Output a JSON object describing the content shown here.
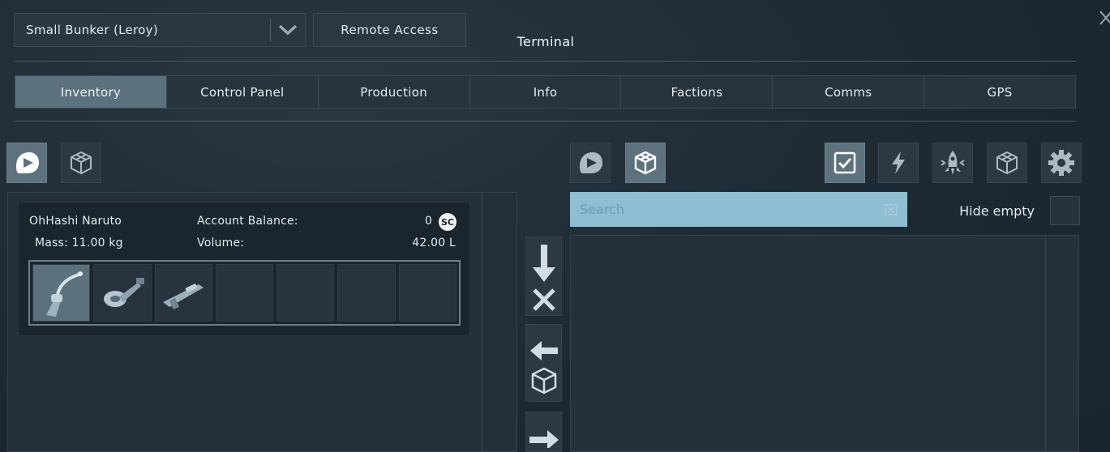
{
  "header": {
    "grid_selector": {
      "value": "Small Bunker (Leroy)"
    },
    "remote_access_label": "Remote Access",
    "title": "Terminal"
  },
  "tabs": [
    {
      "label": "Inventory",
      "active": true
    },
    {
      "label": "Control Panel",
      "active": false
    },
    {
      "label": "Production",
      "active": false
    },
    {
      "label": "Info",
      "active": false
    },
    {
      "label": "Factions",
      "active": false
    },
    {
      "label": "Comms",
      "active": false
    },
    {
      "label": "GPS",
      "active": false
    }
  ],
  "left": {
    "filter_buttons": [
      {
        "icon": "character-helmet-icon",
        "active": true
      },
      {
        "icon": "grid-cubes-icon",
        "active": false
      }
    ],
    "character": {
      "name": "OhHashi Naruto",
      "mass": "Mass: 11.00 kg",
      "balance_label": "Account Balance:",
      "balance_value": "0",
      "currency_badge": "SC",
      "volume_label": "Volume:",
      "volume_value": "42.00 L",
      "slots": [
        {
          "item": "welder-tool-icon",
          "selected": true
        },
        {
          "item": "grinder-tool-icon",
          "selected": false
        },
        {
          "item": "rifle-icon",
          "selected": false
        },
        {
          "item": "",
          "selected": false
        },
        {
          "item": "",
          "selected": false
        },
        {
          "item": "",
          "selected": false
        },
        {
          "item": "",
          "selected": false
        }
      ]
    }
  },
  "transfer": [
    {
      "icon": "arrow-down-cancel-icon"
    },
    {
      "icon": "arrow-left-grid-icon"
    },
    {
      "icon": "arrow-right-icon"
    }
  ],
  "right": {
    "filter_buttons": [
      {
        "icon": "character-helmet-icon",
        "active": false
      },
      {
        "icon": "grid-cubes-icon",
        "active": true
      }
    ],
    "type_filters": [
      {
        "icon": "checkbox-all-icon",
        "active": true
      },
      {
        "icon": "lightning-icon",
        "active": false
      },
      {
        "icon": "rocket-icon",
        "active": false
      },
      {
        "icon": "cubes-icon",
        "active": false
      },
      {
        "icon": "gear-icon",
        "active": false
      }
    ],
    "search": {
      "placeholder": "Search",
      "value": ""
    },
    "hide_empty_label": "Hide empty",
    "hide_empty_checked": false
  },
  "colors": {
    "background": "#1e2a33",
    "active_tab": "#5c717e",
    "search_bg": "#8fbdd2",
    "text": "#e3ebf0"
  }
}
